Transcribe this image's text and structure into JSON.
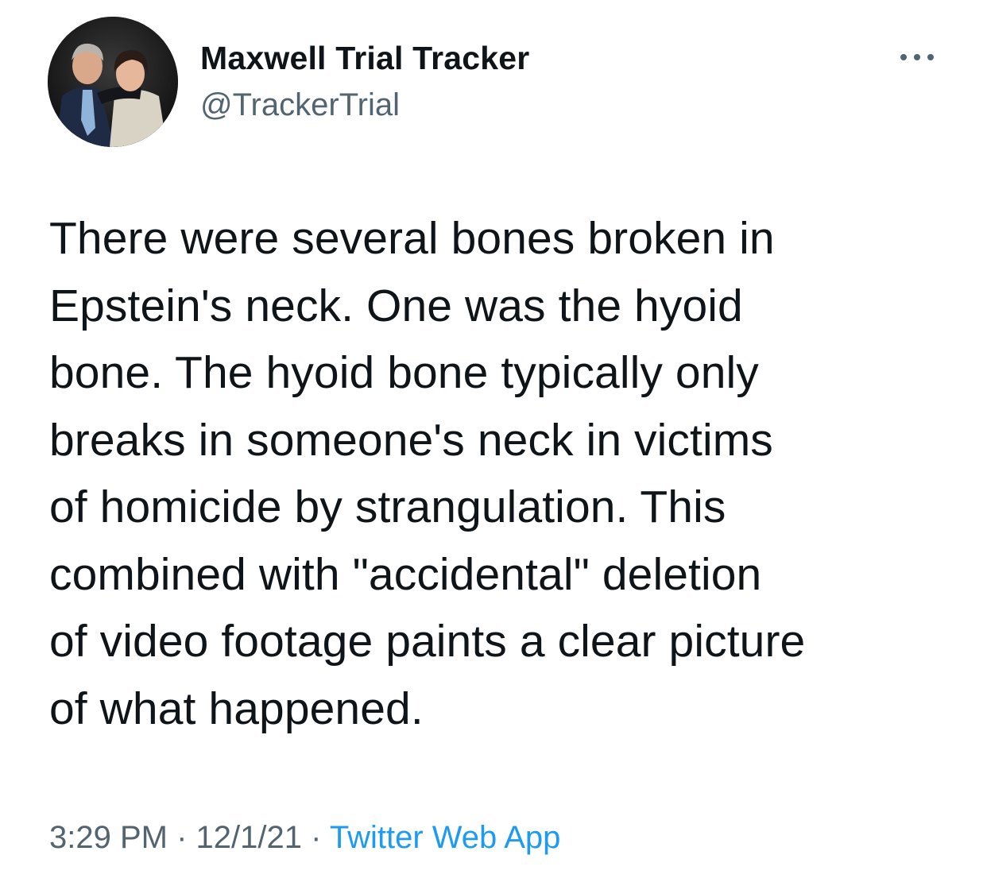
{
  "tweet": {
    "author": {
      "display_name": "Maxwell Trial Tracker",
      "handle": "@TrackerTrial",
      "avatar_icon": "profile-photo"
    },
    "more_icon": "ellipsis-icon",
    "text": "There were several bones broken in\nEpstein's neck. One was the hyoid\nbone. The hyoid bone typically only\nbreaks in someone's neck in victims\nof homicide by strangulation. This\ncombined with \"accidental\" deletion\nof video footage paints a clear picture\nof what happened.",
    "time": "3:29 PM",
    "separator": "·",
    "date": "12/1/21",
    "source": "Twitter Web App"
  },
  "colors": {
    "text_primary": "#0f1419",
    "text_secondary": "#536471",
    "link": "#1d9bf0"
  }
}
